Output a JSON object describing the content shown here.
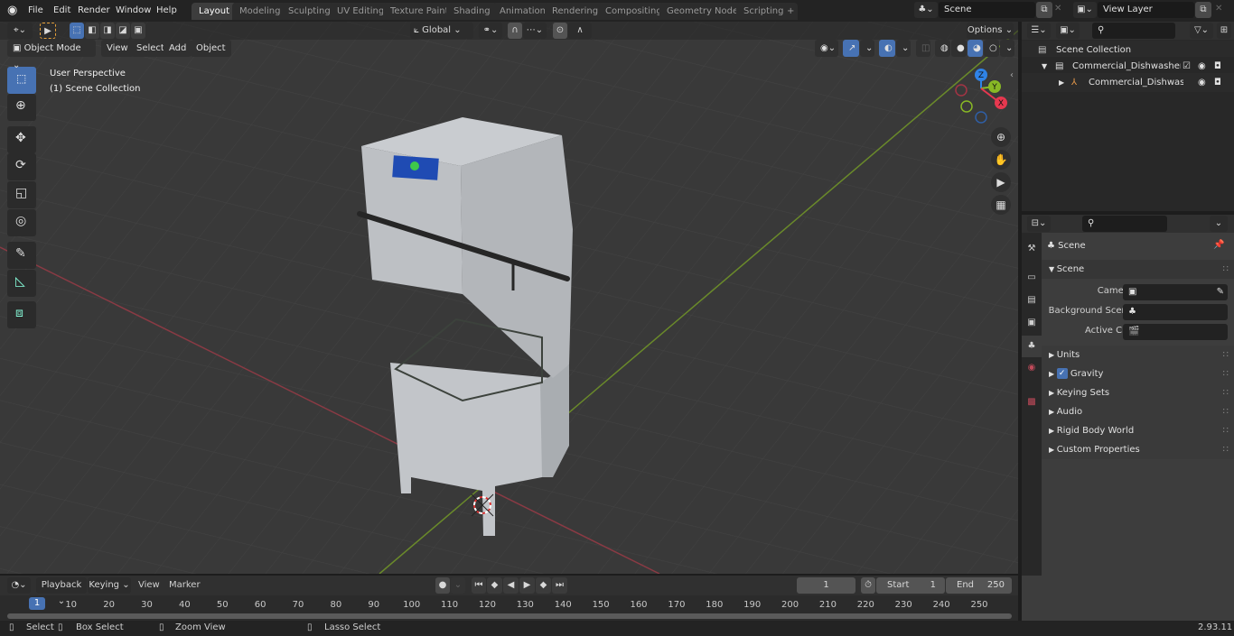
{
  "app": {
    "version": "2.93.11"
  },
  "topbar": {
    "menus": [
      "File",
      "Edit",
      "Render",
      "Window",
      "Help"
    ],
    "workspaces": [
      "Layout",
      "Modeling",
      "Sculpting",
      "UV Editing",
      "Texture Paint",
      "Shading",
      "Animation",
      "Rendering",
      "Compositing",
      "Geometry Nodes",
      "Scripting"
    ],
    "active_workspace": "Layout",
    "add_tab": "+",
    "scene_name": "Scene",
    "view_layer_name": "View Layer"
  },
  "viewport": {
    "mode": "Object Mode",
    "menus": [
      "View",
      "Select",
      "Add",
      "Object"
    ],
    "transform_orientation": "Global",
    "options_label": "Options",
    "overlay_title": "User Perspective",
    "overlay_collection": "(1) Scene Collection",
    "gizmo_axes": [
      "X",
      "Y",
      "Z"
    ],
    "tools": [
      "select-box",
      "cursor",
      "move",
      "rotate",
      "scale",
      "transform",
      "annotate",
      "measure",
      "add-cube"
    ],
    "nav_buttons": [
      "zoom",
      "pan",
      "camera",
      "grid"
    ],
    "axis_colors": {
      "x": "#e6384f",
      "y": "#88b825",
      "z": "#2f83e6"
    }
  },
  "outliner": {
    "search_placeholder": "",
    "root": "Scene Collection",
    "items": [
      {
        "label": "Commercial_Dishwasher_Hoc",
        "type": "collection",
        "checked": true
      },
      {
        "label": "Commercial_Dishwasher_",
        "type": "empty"
      }
    ]
  },
  "properties": {
    "context_title": "Scene",
    "section_scene": "Scene",
    "fields": [
      {
        "label": "Camera",
        "value": ""
      },
      {
        "label": "Background Scene",
        "value": ""
      },
      {
        "label": "Active Clip",
        "value": ""
      }
    ],
    "panels": [
      "Units",
      "Gravity",
      "Keying Sets",
      "Audio",
      "Rigid Body World",
      "Custom Properties"
    ],
    "gravity_checked": true,
    "tabs": [
      "tool",
      "render",
      "output",
      "view-layer",
      "scene",
      "world",
      "texture"
    ]
  },
  "timeline": {
    "menus": [
      "Playback",
      "Keying",
      "View",
      "Marker"
    ],
    "current_frame": "1",
    "start_label": "Start",
    "start": "1",
    "end_label": "End",
    "end": "250",
    "ticks": [
      "10",
      "20",
      "30",
      "40",
      "50",
      "60",
      "70",
      "80",
      "90",
      "100",
      "110",
      "120",
      "130",
      "140",
      "150",
      "160",
      "170",
      "180",
      "190",
      "200",
      "210",
      "220",
      "230",
      "240",
      "250"
    ],
    "playhead": "1"
  },
  "statusbar": {
    "hints": [
      "Select",
      "Box Select",
      "Zoom View",
      "Lasso Select"
    ]
  }
}
